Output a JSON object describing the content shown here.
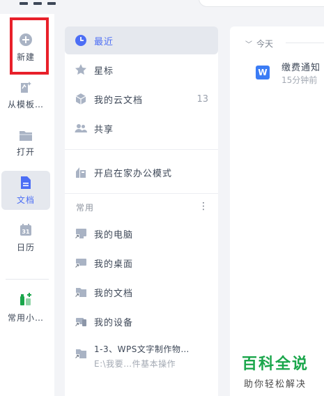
{
  "colors": {
    "accent": "#4c6ef5",
    "highlight_border": "#e8202a",
    "word_icon": "#3b7cf5",
    "badge_green": "#1aa64b",
    "recent_active_bg": "#e5e8ee"
  },
  "rail": {
    "items": [
      {
        "label": "新建",
        "icon": "plus-circle-icon"
      },
      {
        "label": "从模板…",
        "icon": "template-icon"
      },
      {
        "label": "打开",
        "icon": "folder-icon"
      },
      {
        "label": "文档",
        "icon": "document-icon"
      },
      {
        "label": "日历",
        "icon": "calendar-icon",
        "calendar_day": "31"
      },
      {
        "label": "常用小…",
        "icon": "tools-icon"
      }
    ]
  },
  "nav": {
    "items": [
      {
        "label": "最近",
        "icon": "clock-icon"
      },
      {
        "label": "星标",
        "icon": "star-icon"
      },
      {
        "label": "我的云文档",
        "icon": "cloud-cube-icon",
        "count": "13"
      },
      {
        "label": "共享",
        "icon": "people-icon"
      },
      {
        "label": "开启在家办公模式",
        "icon": "home-office-icon"
      }
    ],
    "group_label": "常用",
    "group_more": "⋮",
    "shortcuts": [
      {
        "label": "我的电脑",
        "icon": "computer-shortcut-icon"
      },
      {
        "label": "我的桌面",
        "icon": "desktop-shortcut-icon"
      },
      {
        "label": "我的文档",
        "icon": "folder-shortcut-icon"
      },
      {
        "label": "我的设备",
        "icon": "device-shortcut-icon"
      },
      {
        "label": "1-3、WPS文字制作物…",
        "sub": "E:\\我要…件基本操作",
        "icon": "folder-shortcut-icon"
      }
    ]
  },
  "content": {
    "day_header": "今天",
    "files": [
      {
        "name": "缴费通知",
        "time": "15分钟前",
        "icon_letter": "W"
      }
    ]
  },
  "watermark": {
    "title": "百科全说",
    "subtitle": "助你轻松解决"
  }
}
